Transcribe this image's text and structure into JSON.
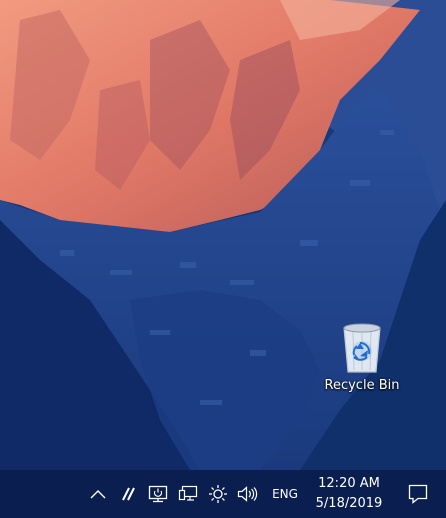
{
  "desktop": {
    "icons": [
      {
        "label": "Recycle Bin",
        "icon": "recycle-bin-icon"
      }
    ]
  },
  "taskbar": {
    "tray_icons": [
      {
        "name": "show-hidden-icons",
        "icon": "chevron-up-icon"
      },
      {
        "name": "pen-workspace",
        "icon": "pen-icon"
      },
      {
        "name": "remote-display",
        "icon": "monitor-power-icon"
      },
      {
        "name": "network",
        "icon": "network-icon"
      },
      {
        "name": "brightness",
        "icon": "sun-icon"
      },
      {
        "name": "volume",
        "icon": "speaker-icon"
      }
    ],
    "language": "ENG",
    "clock": {
      "time": "12:20 AM",
      "date": "5/18/2019"
    },
    "action_center_icon": "notification-icon"
  },
  "colors": {
    "taskbar_bg": "#0a1f4f",
    "desktop_bg": "#0c2a62",
    "mountain_peak": "#e8836e"
  }
}
